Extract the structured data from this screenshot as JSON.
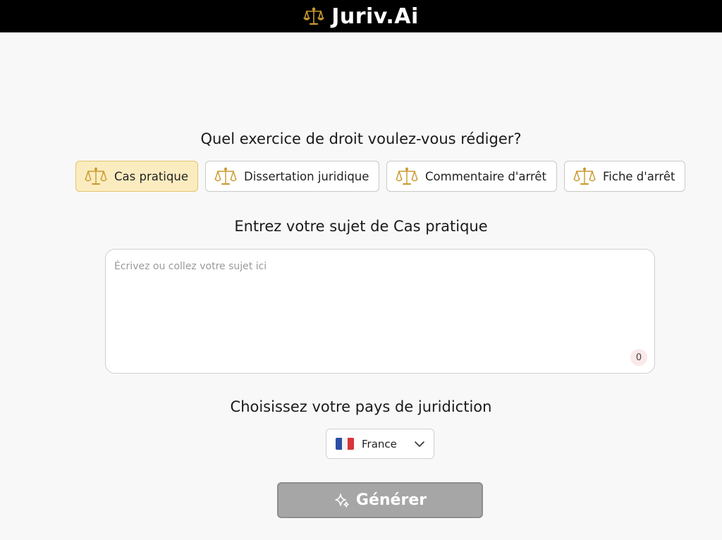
{
  "header": {
    "title": "Juriv.Ai",
    "logo_icon": "scale-icon"
  },
  "exercise": {
    "question": "Quel exercice de droit voulez-vous rédiger?",
    "tabs": [
      {
        "label": "Cas pratique",
        "icon": "scale-icon",
        "active": true
      },
      {
        "label": "Dissertation juridique",
        "icon": "scale-icon",
        "active": false
      },
      {
        "label": "Commentaire d'arrêt",
        "icon": "scale-icon",
        "active": false
      },
      {
        "label": "Fiche d'arrêt",
        "icon": "scale-icon",
        "active": false
      }
    ]
  },
  "subject": {
    "heading": "Entrez votre sujet de Cas pratique",
    "placeholder": "Écrivez ou collez votre sujet ici",
    "value": "",
    "char_count": "0"
  },
  "jurisdiction": {
    "heading": "Choisissez votre pays de juridiction",
    "selected": "France",
    "flag_icon": "france-flag-icon"
  },
  "actions": {
    "generate_label": "Générer",
    "generate_icon": "sparkle-icon"
  },
  "colors": {
    "header_bg": "#000000",
    "active_tab_bg": "#fbecbf",
    "active_tab_border": "#e3c470",
    "scale_gold": "#c99a2e",
    "generate_bg": "#a6a6a6",
    "counter_bg": "#fbe9e9"
  }
}
